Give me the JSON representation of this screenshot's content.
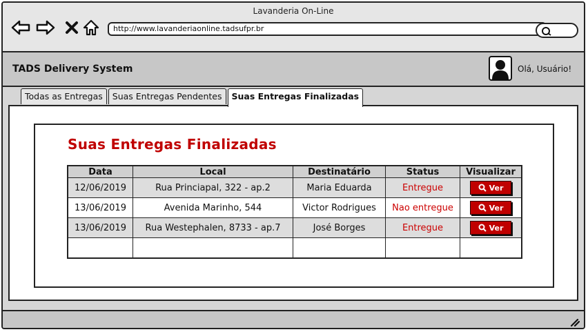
{
  "window": {
    "title": "Lavanderia On-Line",
    "url": "http://www.lavanderiaonline.tadsufpr.br"
  },
  "nav": {
    "icons": [
      "back-arrow-icon",
      "forward-arrow-icon",
      "close-x-icon",
      "home-icon",
      "search-icon"
    ]
  },
  "header": {
    "app_title": "TADS Delivery System",
    "greeting": "Olá, Usuário!"
  },
  "tabs": [
    {
      "label": "Todas as Entregas",
      "active": false
    },
    {
      "label": "Suas Entregas Pendentes",
      "active": false
    },
    {
      "label": "Suas Entregas Finalizadas",
      "active": true
    }
  ],
  "main": {
    "heading": "Suas Entregas Finalizadas",
    "columns": [
      "Data",
      "Local",
      "Destinatário",
      "Status",
      "Visualizar"
    ],
    "rows": [
      {
        "data": "12/06/2019",
        "local": "Rua Princiapal, 322 - ap.2",
        "destinatario": "Maria Eduarda",
        "status": "Entregue",
        "action": "Ver"
      },
      {
        "data": "13/06/2019",
        "local": "Avenida Marinho, 544",
        "destinatario": "Victor Rodrigues",
        "status": "Nao entregue",
        "action": "Ver"
      },
      {
        "data": "13/06/2019",
        "local": "Rua Westephalen, 8733 - ap.7",
        "destinatario": "José Borges",
        "status": "Entregue",
        "action": "Ver"
      }
    ]
  },
  "colors": {
    "accent_red": "#c00000",
    "status_red": "#cc0000",
    "chrome_gray": "#d6d6d6"
  }
}
